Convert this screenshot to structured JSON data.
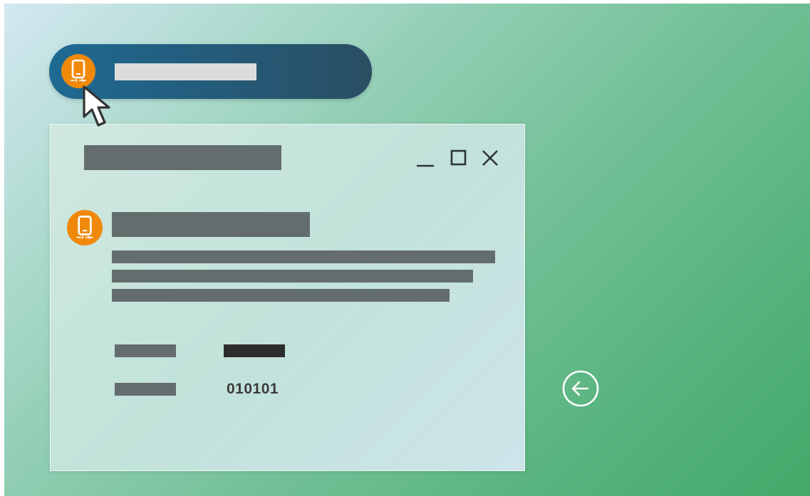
{
  "dialog": {
    "detail_value": "010101"
  },
  "icons": {
    "app": "phone-debug-icon",
    "minimize": "minimize-icon",
    "maximize": "maximize-icon",
    "close": "close-icon",
    "back": "back-arrow-icon",
    "cursor": "cursor-icon"
  },
  "colors": {
    "accent_orange": "#f0890a",
    "pill_blue": "#1e6a93",
    "placeholder_gray": "#636d6d",
    "background_green": "#43a96a"
  }
}
